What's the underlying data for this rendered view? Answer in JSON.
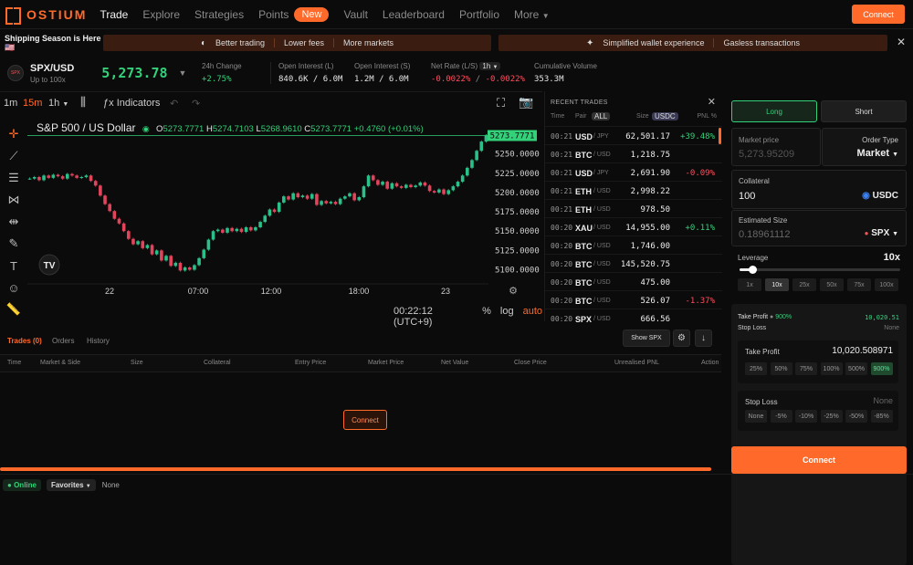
{
  "nav": {
    "logo": "OSTIUM",
    "links": [
      "Trade",
      "Explore",
      "Strategies",
      "Points"
    ],
    "new_badge": "New",
    "links2": [
      "Vault",
      "Leaderboard",
      "Portfolio",
      "More"
    ],
    "connect": "Connect"
  },
  "promo": {
    "left": "Shipping Season is Here 🇺🇸",
    "band1": [
      "Better trading",
      "Lower fees",
      "More markets"
    ],
    "band2": [
      "Simplified wallet experience",
      "Gasless transactions"
    ]
  },
  "ticker": {
    "icon": "SPX",
    "pair": "SPX/USD",
    "sub": "Up to 100x",
    "price": "5,273.78",
    "change_label": "24h Change",
    "change_value": "+2.75%",
    "oi_l_label": "Open Interest (L)",
    "oi_l_value": "840.6K / 6.0M",
    "oi_s_label": "Open Interest (S)",
    "oi_s_value": "1.2M / 6.0M",
    "net_label": "Net Rate (L/S)",
    "net_chip": "1h",
    "net_long": "-0.0022%",
    "net_slash": "/",
    "net_short": "-0.0022%",
    "vol_label": "Cumulative Volume",
    "vol_value": "353.3M"
  },
  "chart_toolbar": {
    "tf1": "1m",
    "tf2": "15m",
    "tf3": "1h",
    "indicators": "Indicators"
  },
  "chart_legend": {
    "title": "S&P 500 / US Dollar",
    "o_l": "O",
    "o": "5273.7771",
    "h_l": "H",
    "h": "5274.7103",
    "l_l": "L",
    "l": "5268.9610",
    "c_l": "C",
    "c": "5273.7771",
    "chg": "+0.4760 (+0.01%)"
  },
  "chart_data": {
    "type": "candlestick",
    "title": "S&P 500 / US Dollar",
    "ylim": [
      5090,
      5285
    ],
    "y_ticks": [
      "5250.0000",
      "5225.0000",
      "5200.0000",
      "5175.0000",
      "5150.0000",
      "5125.0000",
      "5100.0000"
    ],
    "x_ticks": [
      "22",
      "07:00",
      "12:00",
      "18:00",
      "23"
    ],
    "last_price": "5273.7771",
    "closes": [
      5218,
      5220,
      5216,
      5222,
      5219,
      5223,
      5221,
      5218,
      5224,
      5222,
      5219,
      5220,
      5222,
      5215,
      5209,
      5196,
      5185,
      5176,
      5166,
      5160,
      5150,
      5140,
      5133,
      5137,
      5128,
      5132,
      5120,
      5125,
      5112,
      5118,
      5105,
      5109,
      5099,
      5103,
      5100,
      5106,
      5115,
      5126,
      5139,
      5150,
      5152,
      5148,
      5154,
      5150,
      5153,
      5149,
      5155,
      5151,
      5155,
      5162,
      5170,
      5178,
      5175,
      5187,
      5195,
      5191,
      5199,
      5194,
      5196,
      5192,
      5198,
      5184,
      5189,
      5186,
      5188,
      5185,
      5192,
      5195,
      5199,
      5190,
      5194,
      5208,
      5222,
      5216,
      5210,
      5214,
      5205,
      5212,
      5208,
      5206,
      5210,
      5207,
      5209,
      5213,
      5209,
      5202,
      5200,
      5204,
      5198,
      5203,
      5208,
      5214,
      5222,
      5232,
      5242,
      5254,
      5266,
      5274
    ]
  },
  "chart_footer": {
    "time": "00:22:12 (UTC+9)",
    "pct": "%",
    "log": "log",
    "auto": "auto"
  },
  "recent_trades": {
    "title": "RECENT TRADES",
    "h_time": "Time",
    "h_pair": "Pair",
    "h_all": "ALL",
    "h_size": "Size",
    "h_usdc": "USDC",
    "h_pnl": "PNL %",
    "rows": [
      {
        "time": "00:21",
        "base": "USD",
        "quote": "/ JPY",
        "size": "62,501.17",
        "pnl": "+39.48%",
        "pnl_color": "#33d17a"
      },
      {
        "time": "00:21",
        "base": "BTC",
        "quote": "/ USD",
        "size": "1,218.75",
        "pnl": "",
        "pnl_color": "#33d17a"
      },
      {
        "time": "00:21",
        "base": "USD",
        "quote": "/ JPY",
        "size": "2,691.90",
        "pnl": "-0.09%",
        "pnl_color": "#ff4d5e"
      },
      {
        "time": "00:21",
        "base": "ETH",
        "quote": "/ USD",
        "size": "2,998.22",
        "pnl": "",
        "pnl_color": "#33d17a"
      },
      {
        "time": "00:21",
        "base": "ETH",
        "quote": "/ USD",
        "size": "978.50",
        "pnl": "",
        "pnl_color": "#33d17a"
      },
      {
        "time": "00:20",
        "base": "XAU",
        "quote": "/ USD",
        "size": "14,955.00",
        "pnl": "+0.11%",
        "pnl_color": "#33d17a"
      },
      {
        "time": "00:20",
        "base": "BTC",
        "quote": "/ USD",
        "size": "1,746.00",
        "pnl": "",
        "pnl_color": "#33d17a"
      },
      {
        "time": "00:20",
        "base": "BTC",
        "quote": "/ USD",
        "size": "145,520.75",
        "pnl": "",
        "pnl_color": "#33d17a"
      },
      {
        "time": "00:20",
        "base": "BTC",
        "quote": "/ USD",
        "size": "475.00",
        "pnl": "",
        "pnl_color": "#33d17a"
      },
      {
        "time": "00:20",
        "base": "BTC",
        "quote": "/ USD",
        "size": "526.07",
        "pnl": "-1.37%",
        "pnl_color": "#ff4d5e"
      },
      {
        "time": "00:20",
        "base": "SPX",
        "quote": "/ USD",
        "size": "666.56",
        "pnl": "",
        "pnl_color": "#33d17a"
      }
    ]
  },
  "order": {
    "long": "Long",
    "short": "Short",
    "market_price_label": "Market price",
    "market_price_value": "5,273.95209",
    "order_type_label": "Order Type",
    "order_type_value": "Market",
    "collateral_label": "Collateral",
    "collateral_value": "100",
    "collateral_token": "USDC",
    "size_label": "Estimated Size",
    "size_value": "0.18961112",
    "size_token": "SPX",
    "leverage_label": "Leverage",
    "leverage_value": "10x",
    "leverage_level": 0.08,
    "lev_options": [
      "1x",
      "10x",
      "25x",
      "50x",
      "75x",
      "100x"
    ],
    "tp_label": "Take Profit",
    "tp_pct": "900%",
    "tp_value": "10,020.51",
    "sl_label": "Stop Loss",
    "sl_value": "None",
    "tp_box_label": "Take Profit",
    "tp_box_value": "10,020.508971",
    "tp_options": [
      "25%",
      "50%",
      "75%",
      "100%",
      "500%",
      "900%"
    ],
    "sl_box_label": "Stop Loss",
    "sl_box_value": "None",
    "sl_options": [
      "None",
      "-5%",
      "-10%",
      "-25%",
      "-50%",
      "-85%"
    ],
    "connect": "Connect"
  },
  "bottom": {
    "tab_trades": "Trades (0)",
    "tab_orders": "Orders",
    "tab_history": "History",
    "show_spx": "Show SPX",
    "columns": [
      "Time",
      "Market & Side",
      "Size",
      "Collateral",
      "Entry Price",
      "Market Price",
      "Net Value",
      "Close Price",
      "Unrealised PNL",
      "Action"
    ],
    "connect": "Connect"
  },
  "footer": {
    "online": "Online",
    "favorites": "Favorites",
    "none": "None"
  }
}
